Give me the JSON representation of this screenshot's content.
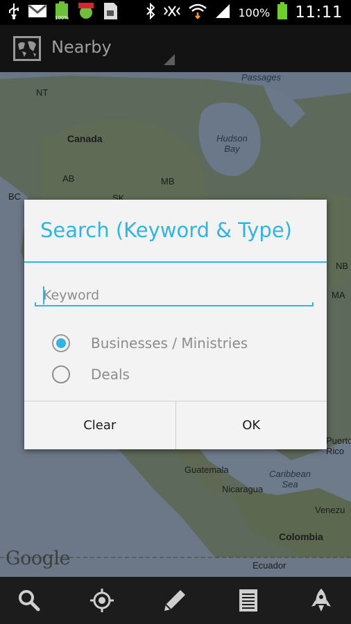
{
  "status_bar": {
    "battery_percent": "100%",
    "time": "11:11",
    "notification_badge": "100%"
  },
  "action_bar": {
    "title": "Nearby"
  },
  "map": {
    "labels": {
      "passages": "Passages",
      "nt": "NT",
      "canada": "Canada",
      "hudson_bay": "Hudson\nBay",
      "ab": "AB",
      "mb": "MB",
      "bc": "BC",
      "sk": "SK",
      "nb": "NB",
      "ma": "MA",
      "puerto_rico": "Puerto\nRico",
      "guatemala": "Guatemala",
      "caribbean_sea": "Caribbean\nSea",
      "nicaragua": "Nicaragua",
      "venezuela": "Venezu",
      "colombia": "Colombia",
      "ecuador": "Ecuador"
    },
    "attribution": "Google"
  },
  "dialog": {
    "title": "Search (Keyword & Type)",
    "keyword_placeholder": "Keyword",
    "keyword_value": "",
    "options": [
      {
        "label": "Businesses / Ministries",
        "checked": true
      },
      {
        "label": "Deals",
        "checked": false
      }
    ],
    "clear_label": "Clear",
    "ok_label": "OK"
  },
  "bottom_bar": {
    "items": [
      "search-icon",
      "locate-icon",
      "pencil-icon",
      "list-icon",
      "rocket-icon"
    ]
  },
  "colors": {
    "accent": "#2fb4e4",
    "dialog_bg": "#f3f3f3",
    "bar_bg": "#1c1c1c"
  }
}
